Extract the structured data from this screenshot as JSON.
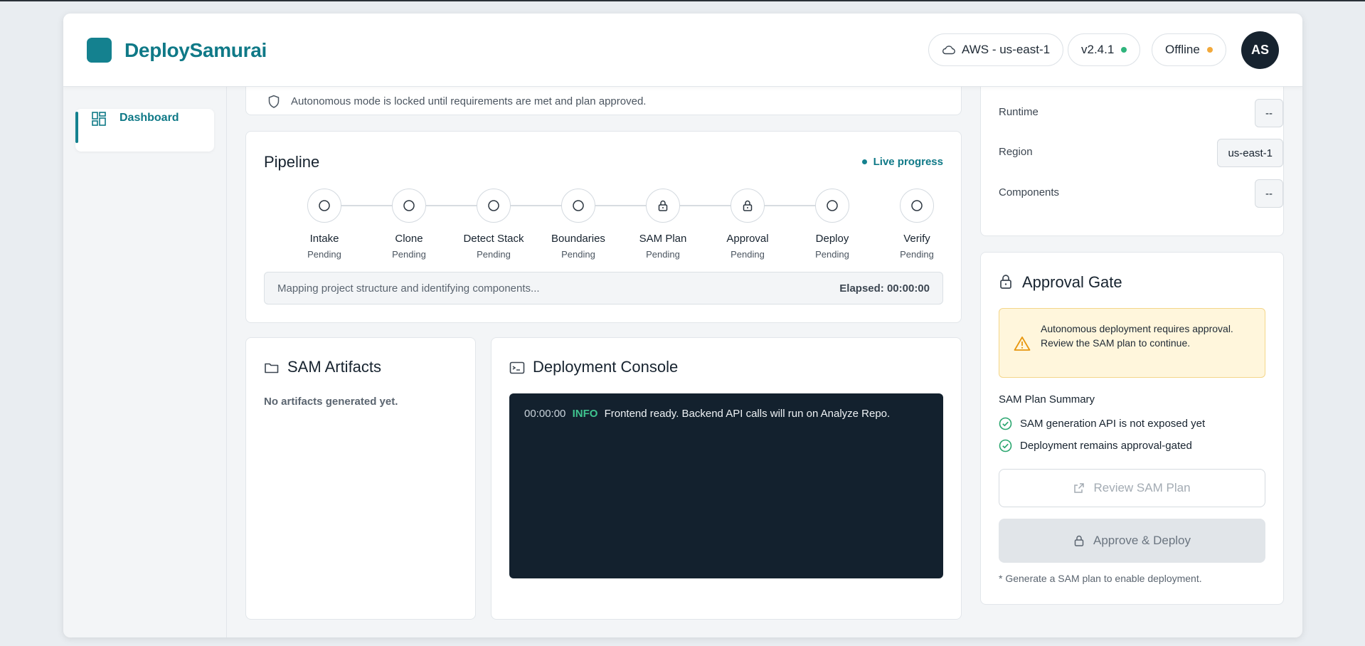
{
  "app": {
    "brand": "DeploySamurai",
    "region_pill": "AWS - us-east-1",
    "version_pill": "v2.4.1",
    "status_pill": "Offline",
    "avatar_initials": "AS",
    "colors": {
      "accent": "#14818f",
      "version_dot": "#2fb47c",
      "status_dot": "#f2a93b",
      "console_bg": "#13212e",
      "info": "#3fc48f"
    }
  },
  "sidebar": {
    "items": [
      {
        "label": "Dashboard",
        "icon": "dashboard-icon"
      }
    ]
  },
  "notice": {
    "text": "Autonomous mode is locked until requirements are met and plan approved."
  },
  "pipeline": {
    "title": "Pipeline",
    "live_label": "Live progress",
    "steps": [
      {
        "name": "Intake",
        "status": "Pending",
        "icon": "circle-icon"
      },
      {
        "name": "Clone",
        "status": "Pending",
        "icon": "circle-icon"
      },
      {
        "name": "Detect Stack",
        "status": "Pending",
        "icon": "circle-icon"
      },
      {
        "name": "Boundaries",
        "status": "Pending",
        "icon": "circle-icon"
      },
      {
        "name": "SAM Plan",
        "status": "Pending",
        "icon": "lock-icon"
      },
      {
        "name": "Approval",
        "status": "Pending",
        "icon": "lock-icon"
      },
      {
        "name": "Deploy",
        "status": "Pending",
        "icon": "circle-icon"
      },
      {
        "name": "Verify",
        "status": "Pending",
        "icon": "circle-icon"
      }
    ],
    "status_message": "Mapping project structure and identifying components...",
    "elapsed": "Elapsed: 00:00:00"
  },
  "artifacts": {
    "title": "SAM Artifacts",
    "empty_text": "No artifacts generated yet."
  },
  "console": {
    "title": "Deployment Console",
    "lines": [
      {
        "time": "00:00:00",
        "level": "INFO",
        "message": "Frontend ready. Backend API calls will run on Analyze Repo."
      }
    ]
  },
  "details": {
    "rows": [
      {
        "label": "Runtime",
        "value": "--"
      },
      {
        "label": "Region",
        "value": "us-east-1"
      },
      {
        "label": "Components",
        "value": "--"
      }
    ]
  },
  "approval": {
    "title": "Approval Gate",
    "alert": "Autonomous deployment requires approval. Review the SAM plan to continue.",
    "summary_title": "SAM Plan Summary",
    "summary_items": [
      "SAM generation API is not exposed yet",
      "Deployment remains approval-gated"
    ],
    "review_button": "Review SAM Plan",
    "approve_button": "Approve & Deploy",
    "footnote": "* Generate a SAM plan to enable deployment."
  }
}
